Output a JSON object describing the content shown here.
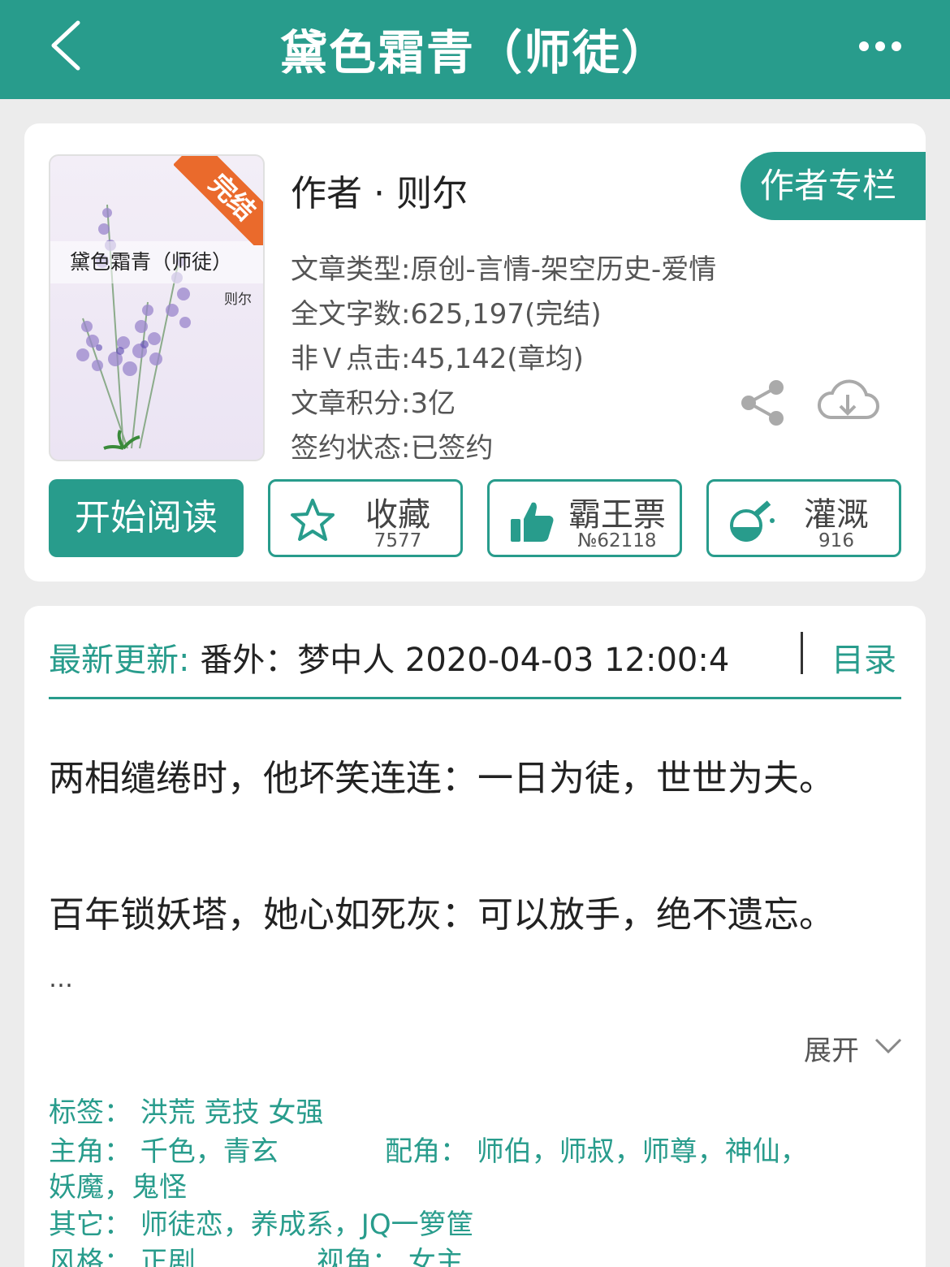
{
  "header": {
    "title": "黛色霜青（师徒）",
    "back_icon": "chevron-left-icon",
    "more_icon": "more-dots-icon"
  },
  "book": {
    "cover_title": "黛色霜青（师徒）",
    "cover_author": "则尔",
    "status_ribbon": "完结",
    "author_line": "作者 · 则尔",
    "author_column_label": "作者专栏",
    "info": [
      "文章类型:原创-言情-架空历史-爱情",
      "全文字数:625,197(完结)",
      "非Ｖ点击:45,142(章均)",
      "文章积分:3亿",
      "签约状态:已签约"
    ]
  },
  "actions": {
    "read_label": "开始阅读",
    "collect": {
      "label": "收藏",
      "count": "7577",
      "icon": "star-icon"
    },
    "ticket": {
      "label": "霸王票",
      "count": "№62118",
      "icon": "thumbs-up-icon"
    },
    "nutrient": {
      "label": "灌溉",
      "count": "916",
      "icon": "flask-icon"
    }
  },
  "latest": {
    "label": "最新更新:",
    "value": " 番外：梦中人 2020-04-03 12:00:4",
    "toc_label": "目录"
  },
  "summary": {
    "lines": [
      "两相缱绻时，他坏笑连连：一日为徒，世世为夫。",
      "百年锁妖塔，她心如死灰：可以放手，绝不遗忘。"
    ],
    "ellipsis": "…",
    "expand_label": "展开"
  },
  "meta": {
    "tags": "标签：  洪荒  竞技   女强",
    "protagonist": "主角：  千色，青玄",
    "supporting": "配角：  师伯，师叔，师尊，神仙，",
    "supporting_cont": "妖魔，鬼怪",
    "other": "其它：  师徒恋，养成系，JQ一箩筐",
    "style": "风格：  正剧",
    "perspective": "视角：  女主"
  },
  "colors": {
    "accent": "#289c8c",
    "ribbon": "#ea6a2c",
    "background": "#ececec"
  }
}
